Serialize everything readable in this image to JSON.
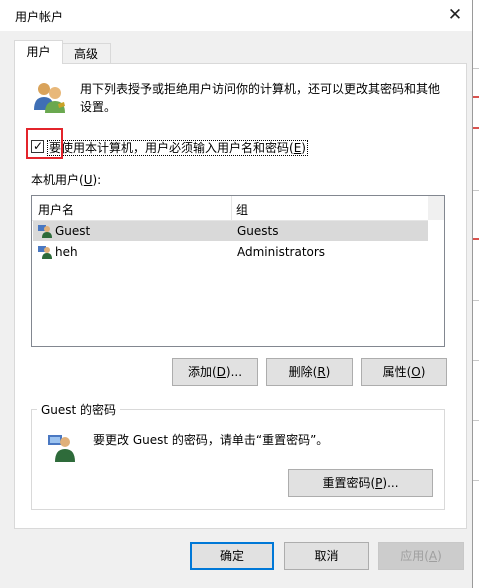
{
  "window": {
    "title": "用户帐户",
    "close_glyph": "✕"
  },
  "tabs": [
    {
      "label": "用户",
      "active": true
    },
    {
      "label": "高级",
      "active": false
    }
  ],
  "intro": {
    "text": "用下列表授予或拒绝用户访问你的计算机，还可以更改其密码和其他设置。"
  },
  "require_login": {
    "checked": true,
    "label_pre": "要使用本计算机，用户必须输入用户名和密码(",
    "label_key": "E",
    "label_post": ")"
  },
  "local_users": {
    "label_pre": "本机用户(",
    "label_key": "U",
    "label_post": "):",
    "columns": [
      "用户名",
      "组"
    ],
    "rows": [
      {
        "name": "Guest",
        "group": "Guests",
        "selected": true
      },
      {
        "name": "heh",
        "group": "Administrators",
        "selected": false
      }
    ]
  },
  "user_buttons": {
    "add": {
      "pre": "添加(",
      "key": "D",
      "post": ")..."
    },
    "delete": {
      "pre": "删除(",
      "key": "R",
      "post": ")"
    },
    "properties": {
      "pre": "属性(",
      "key": "O",
      "post": ")"
    }
  },
  "password_group": {
    "title": "Guest 的密码",
    "text": "要更改 Guest 的密码，请单击“重置密码”。",
    "reset_button": {
      "pre": "重置密码(",
      "key": "P",
      "post": ")..."
    }
  },
  "dialog_buttons": {
    "ok": "确定",
    "cancel": "取消",
    "apply": {
      "pre": "应用(",
      "key": "A",
      "post": ")",
      "enabled": false
    }
  },
  "colors": {
    "accent": "#0078d7",
    "highlight_annotation": "#e3242b",
    "selection": "#d9d9d9"
  }
}
